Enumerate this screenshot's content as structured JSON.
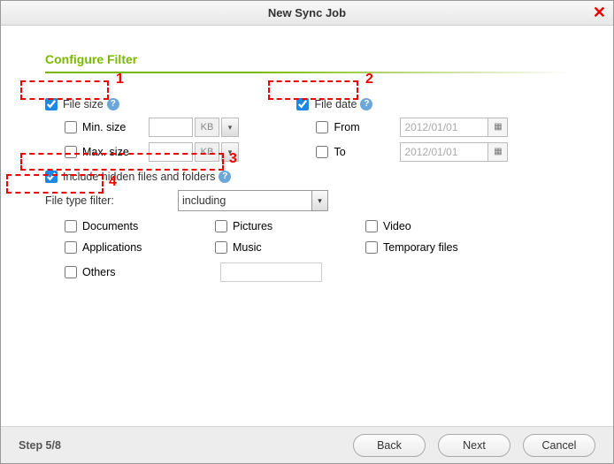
{
  "window": {
    "title": "New Sync Job"
  },
  "section": {
    "title": "Configure Filter"
  },
  "file_size": {
    "label": "File size",
    "checked": true,
    "min": {
      "label": "Min. size",
      "checked": false,
      "value": "",
      "unit": "KB"
    },
    "max": {
      "label": "Max. size",
      "checked": false,
      "value": "",
      "unit": "KB"
    }
  },
  "file_date": {
    "label": "File date",
    "checked": true,
    "from": {
      "label": "From",
      "checked": false,
      "value": "2012/01/01"
    },
    "to": {
      "label": "To",
      "checked": false,
      "value": "2012/01/01"
    }
  },
  "include_hidden": {
    "label": "Include hidden files and folders",
    "checked": true
  },
  "file_type_filter": {
    "label": "File type filter:",
    "mode": "including",
    "options": {
      "documents": {
        "label": "Documents",
        "checked": false
      },
      "pictures": {
        "label": "Pictures",
        "checked": false
      },
      "video": {
        "label": "Video",
        "checked": false
      },
      "applications": {
        "label": "Applications",
        "checked": false
      },
      "music": {
        "label": "Music",
        "checked": false
      },
      "temporary": {
        "label": "Temporary files",
        "checked": false
      },
      "others": {
        "label": "Others",
        "checked": false,
        "value": ""
      }
    }
  },
  "callouts": {
    "c1": "1",
    "c2": "2",
    "c3": "3",
    "c4": "4"
  },
  "footer": {
    "step": "Step 5/8",
    "back": "Back",
    "next": "Next",
    "cancel": "Cancel"
  }
}
